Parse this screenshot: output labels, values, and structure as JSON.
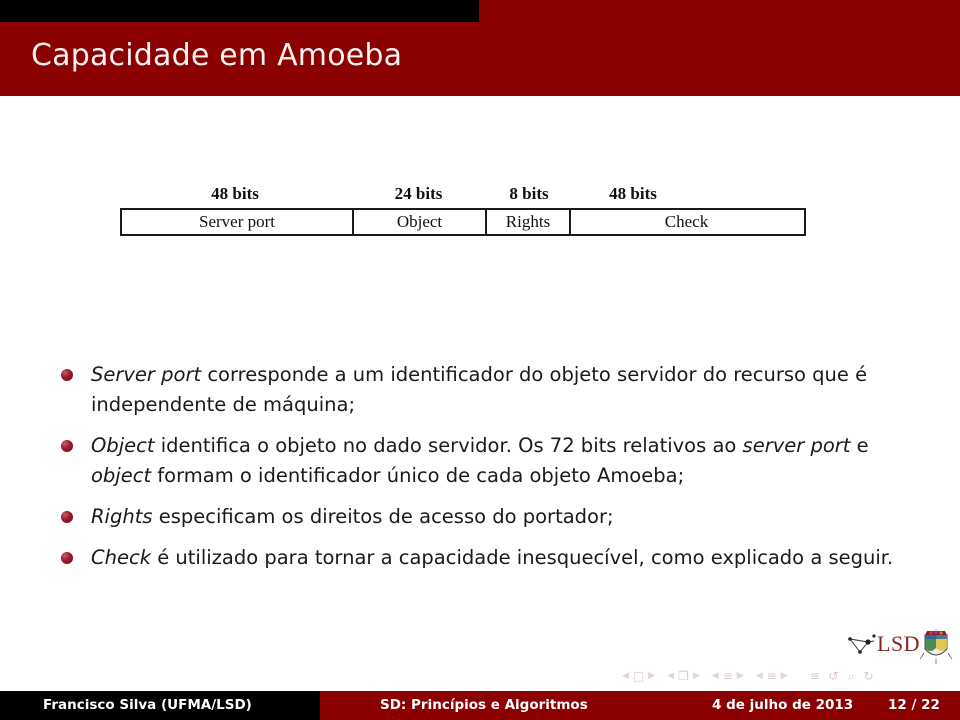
{
  "header": {
    "title": "Capacidade em Amoeba",
    "bar_color": "#8b0000",
    "accent_bar_color": "#000000"
  },
  "diagram": {
    "name": "amoeba-capability-layout",
    "fields": [
      {
        "bits": "48 bits",
        "label": "Server port"
      },
      {
        "bits": "24 bits",
        "label": "Object"
      },
      {
        "bits": "8 bits",
        "label": "Rights"
      },
      {
        "bits": "48 bits",
        "label": "Check"
      }
    ]
  },
  "bullets": [
    {
      "id": "bullet-server-port",
      "parts": [
        {
          "text": "Server port",
          "italic": true
        },
        {
          "text": " corresponde a um identificador do objeto servidor do recurso que é independente de máquina;",
          "italic": false
        }
      ]
    },
    {
      "id": "bullet-object",
      "parts": [
        {
          "text": "Object",
          "italic": true
        },
        {
          "text": " identifica o objeto no dado servidor. Os 72 bits relativos ao ",
          "italic": false
        },
        {
          "text": "server port",
          "italic": true
        },
        {
          "text": " e ",
          "italic": false
        },
        {
          "text": "object",
          "italic": true
        },
        {
          "text": " formam o identificador único de cada objeto Amoeba;",
          "italic": false
        }
      ]
    },
    {
      "id": "bullet-rights",
      "parts": [
        {
          "text": "Rights",
          "italic": true
        },
        {
          "text": " especificam os direitos de acesso do portador;",
          "italic": false
        }
      ]
    },
    {
      "id": "bullet-check",
      "parts": [
        {
          "text": "Check",
          "italic": true
        },
        {
          "text": " é utilizado para tornar a capacidade inesquecível, como explicado a seguir.",
          "italic": false
        }
      ]
    }
  ],
  "logo": {
    "text": "LSD"
  },
  "nav": {
    "groups": [
      {
        "left": "◀",
        "glyph": "□",
        "right": "▶",
        "name": "nav-frame"
      },
      {
        "left": "◀",
        "glyph": "❐",
        "right": "▶",
        "name": "nav-subsection"
      },
      {
        "left": "◀",
        "glyph": "≡",
        "right": "▶",
        "name": "nav-section"
      },
      {
        "left": "◀",
        "glyph": "≡",
        "right": "▶",
        "name": "nav-doc"
      }
    ],
    "tail": [
      {
        "glyph": "≡",
        "name": "nav-toc"
      },
      {
        "glyph": "↺",
        "name": "nav-back"
      },
      {
        "glyph": "⌕",
        "name": "nav-search"
      },
      {
        "glyph": "↻",
        "name": "nav-forward"
      }
    ]
  },
  "footer": {
    "author": "Francisco Silva  (UFMA/LSD)",
    "subject": "SD: Princípios e Algoritmos",
    "date": "4 de julho de 2013",
    "page": "12 / 22"
  }
}
